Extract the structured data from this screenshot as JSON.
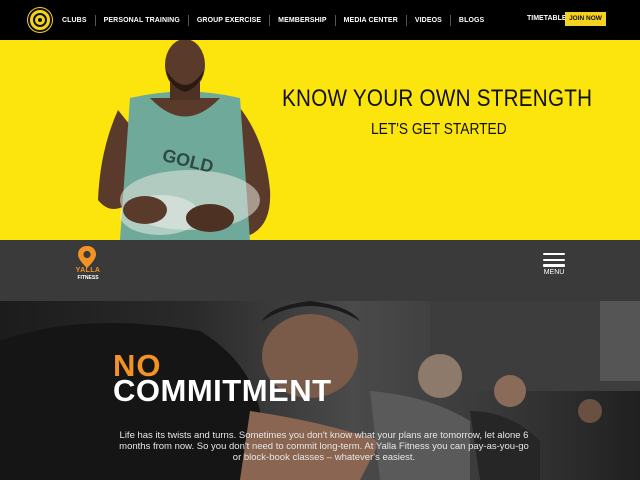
{
  "top_nav": {
    "items": [
      "CLUBS",
      "PERSONAL TRAINING",
      "GROUP EXERCISE",
      "MEMBERSHIP",
      "MEDIA CENTER",
      "VIDEOS",
      "BLOGS"
    ],
    "timetable": "TIMETABLE",
    "join": "JOIN NOW",
    "logo_icon": "golds-gym-logo",
    "accent": "#f5d21f"
  },
  "hero": {
    "title": "KNOW YOUR OWN STRENGTH",
    "subtitle": "LET'S GET STARTED",
    "background": "#fbe50d"
  },
  "yalla": {
    "brand": "YALLA",
    "brand_sub": "FITNESS",
    "menu_label": "MENU",
    "pin_icon": "location-pin-icon",
    "accent": "#f39325"
  },
  "feature": {
    "headline_1": "NO",
    "headline_2": "COMMITMENT",
    "body": "Life has its twists and turns. Sometimes you don't know what your plans are tomorrow, let alone 6 months from now. So you don't need to commit long-term. At Yalla Fitness you can pay-as-you-go or block-book classes – whatever's easiest."
  }
}
